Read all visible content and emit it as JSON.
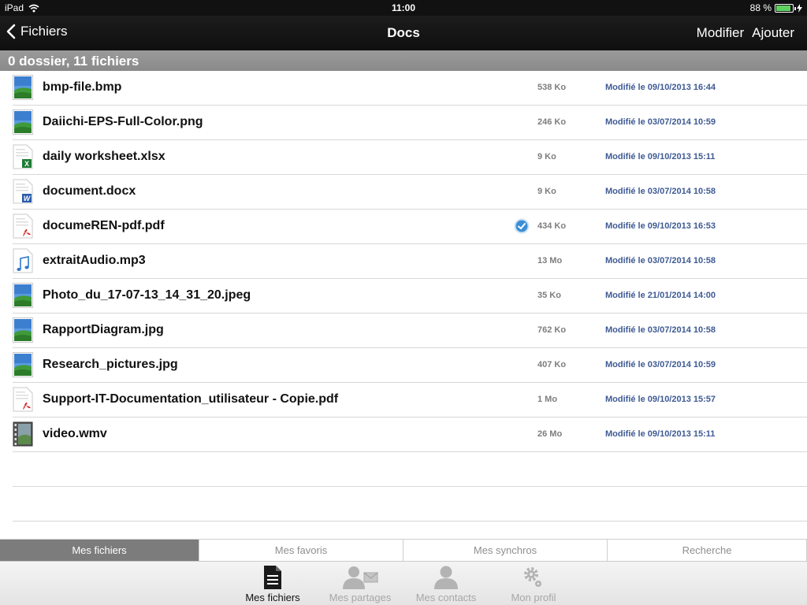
{
  "status_bar": {
    "device": "iPad",
    "time": "11:00",
    "battery": "88 %",
    "battery_level": 0.88
  },
  "nav": {
    "back_label": "Fichiers",
    "title": "Docs",
    "edit_label": "Modifier",
    "add_label": "Ajouter"
  },
  "section_header": "0 dossier, 11 fichiers",
  "files": [
    {
      "name": "bmp-file.bmp",
      "size": "538 Ko",
      "modified": "Modifié le 09/10/2013 16:44",
      "type": "image",
      "synced": false
    },
    {
      "name": "Daiichi-EPS-Full-Color.png",
      "size": "246 Ko",
      "modified": "Modifié le 03/07/2014 10:59",
      "type": "image",
      "synced": false
    },
    {
      "name": "daily worksheet.xlsx",
      "size": "9 Ko",
      "modified": "Modifié le 09/10/2013 15:11",
      "type": "excel",
      "synced": false
    },
    {
      "name": "document.docx",
      "size": "9 Ko",
      "modified": "Modifié le 03/07/2014 10:58",
      "type": "word",
      "synced": false
    },
    {
      "name": "documeREN-pdf.pdf",
      "size": "434 Ko",
      "modified": "Modifié le 09/10/2013 16:53",
      "type": "pdf",
      "synced": true
    },
    {
      "name": "extraitAudio.mp3",
      "size": "13 Mo",
      "modified": "Modifié le 03/07/2014 10:58",
      "type": "audio",
      "synced": false
    },
    {
      "name": "Photo_du_17-07-13_14_31_20.jpeg",
      "size": "35 Ko",
      "modified": "Modifié le 21/01/2014 14:00",
      "type": "image",
      "synced": false
    },
    {
      "name": "RapportDiagram.jpg",
      "size": "762 Ko",
      "modified": "Modifié le 03/07/2014 10:58",
      "type": "image",
      "synced": false
    },
    {
      "name": "Research_pictures.jpg",
      "size": "407 Ko",
      "modified": "Modifié le 03/07/2014 10:59",
      "type": "image",
      "synced": false
    },
    {
      "name": "Support-IT-Documentation_utilisateur - Copie.pdf",
      "size": "1 Mo",
      "modified": "Modifié le 09/10/2013 15:57",
      "type": "pdf",
      "synced": false
    },
    {
      "name": "video.wmv",
      "size": "26 Mo",
      "modified": "Modifié le 09/10/2013 15:11",
      "type": "video",
      "synced": false
    }
  ],
  "segments": [
    {
      "label": "Mes fichiers",
      "active": true
    },
    {
      "label": "Mes favoris",
      "active": false
    },
    {
      "label": "Mes synchros",
      "active": false
    },
    {
      "label": "Recherche",
      "active": false
    }
  ],
  "tabs": [
    {
      "label": "Mes fichiers",
      "icon": "document-icon",
      "active": true
    },
    {
      "label": "Mes partages",
      "icon": "share-icon",
      "active": false
    },
    {
      "label": "Mes contacts",
      "icon": "contacts-icon",
      "active": false
    },
    {
      "label": "Mon profil",
      "icon": "settings-icon",
      "active": false
    }
  ],
  "colors": {
    "date_text": "#3e5a93",
    "size_text": "#7d7d7d",
    "header_bg": "#8f8f8f",
    "navbar_bg": "#151515",
    "sync_badge": "#3a8fd6",
    "excel": "#1e7b34",
    "word": "#2a5cab",
    "pdf": "#d22b2b"
  }
}
